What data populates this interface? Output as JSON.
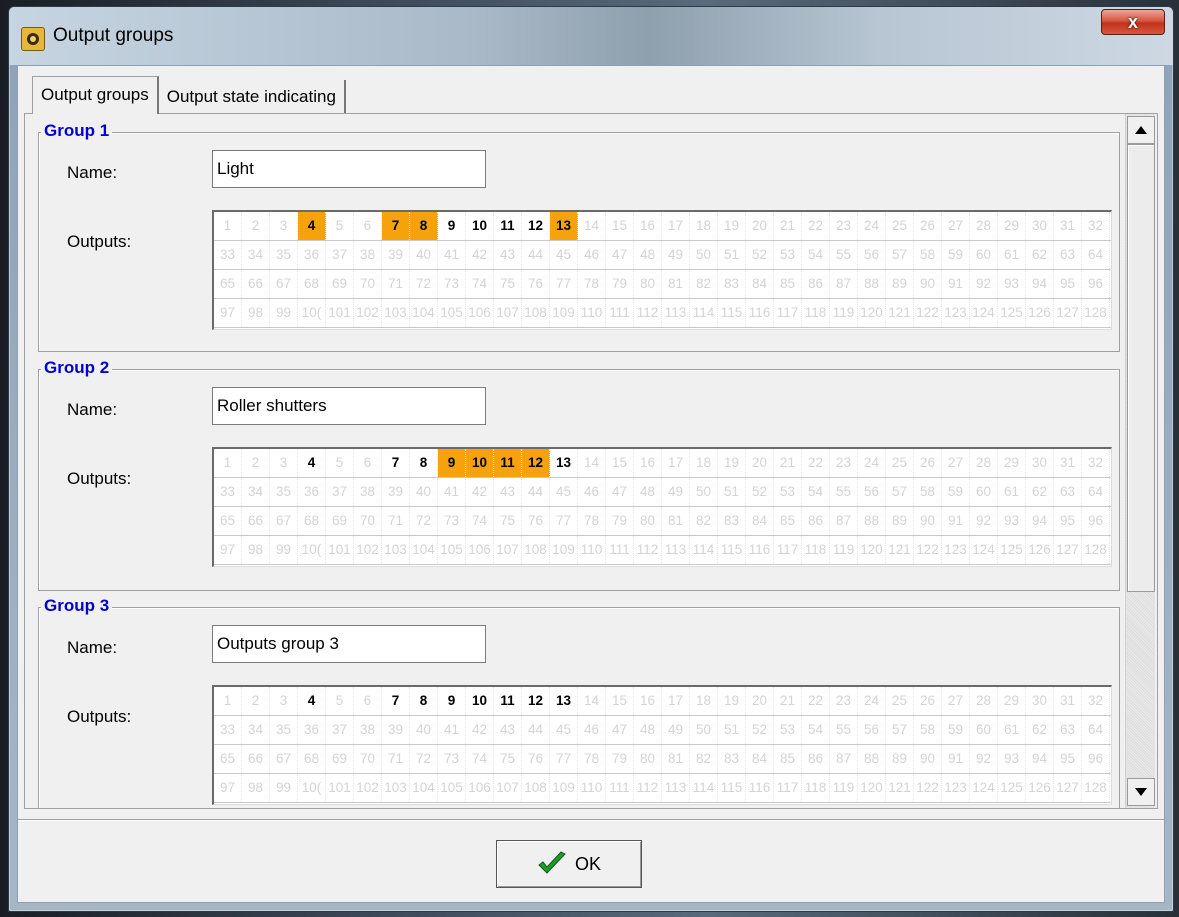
{
  "window": {
    "title": "Output groups",
    "close_label": "x"
  },
  "tabs": [
    {
      "label": "Output groups",
      "active": true
    },
    {
      "label": "Output state indicating",
      "active": false
    }
  ],
  "labels": {
    "name": "Name:",
    "outputs": "Outputs:"
  },
  "output_grid": {
    "rows": [
      [
        "1",
        "2",
        "3",
        "4",
        "5",
        "6",
        "7",
        "8",
        "9",
        "10",
        "11",
        "12",
        "13",
        "14",
        "15",
        "16",
        "17",
        "18",
        "19",
        "20",
        "21",
        "22",
        "23",
        "24",
        "25",
        "26",
        "27",
        "28",
        "29",
        "30",
        "31",
        "32"
      ],
      [
        "33",
        "34",
        "35",
        "36",
        "37",
        "38",
        "39",
        "40",
        "41",
        "42",
        "43",
        "44",
        "45",
        "46",
        "47",
        "48",
        "49",
        "50",
        "51",
        "52",
        "53",
        "54",
        "55",
        "56",
        "57",
        "58",
        "59",
        "60",
        "61",
        "62",
        "63",
        "64"
      ],
      [
        "65",
        "66",
        "67",
        "68",
        "69",
        "70",
        "71",
        "72",
        "73",
        "74",
        "75",
        "76",
        "77",
        "78",
        "79",
        "80",
        "81",
        "82",
        "83",
        "84",
        "85",
        "86",
        "87",
        "88",
        "89",
        "90",
        "91",
        "92",
        "93",
        "94",
        "95",
        "96"
      ],
      [
        "97",
        "98",
        "99",
        "10(",
        "101",
        "102",
        "103",
        "104",
        "105",
        "106",
        "107",
        "108",
        "109",
        "110",
        "111",
        "112",
        "113",
        "114",
        "115",
        "116",
        "117",
        "118",
        "119",
        "120",
        "121",
        "122",
        "123",
        "124",
        "125",
        "126",
        "127",
        "128"
      ]
    ],
    "available_outputs": [
      4,
      7,
      8,
      9,
      10,
      11,
      12,
      13
    ]
  },
  "groups": [
    {
      "title": "Group 1",
      "name": "Light",
      "selected_outputs": [
        4,
        7,
        8,
        13
      ]
    },
    {
      "title": "Group 2",
      "name": "Roller shutters",
      "selected_outputs": [
        9,
        10,
        11,
        12
      ]
    },
    {
      "title": "Group 3",
      "name": "Outputs group 3",
      "selected_outputs": []
    }
  ],
  "footer": {
    "ok_label": "OK"
  },
  "colors": {
    "selected": "#f5a20d",
    "group_title": "#0000d0"
  }
}
